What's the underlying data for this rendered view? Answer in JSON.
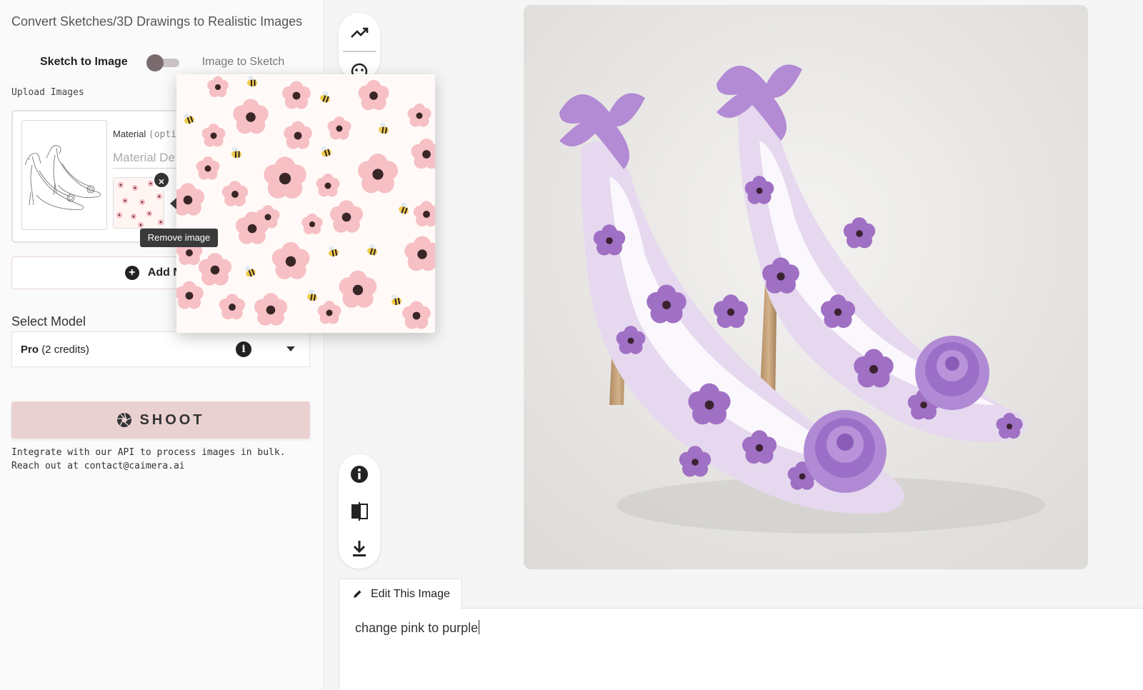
{
  "app_title": "Convert Sketches/3D Drawings to Realistic Images",
  "mode_toggle": {
    "left_label": "Sketch to Image",
    "right_label": "Image to Sketch",
    "selected": "Sketch to Image"
  },
  "upload": {
    "label": "Upload Images",
    "material_label": "Material",
    "material_optional": "(opti",
    "material_placeholder": "Material De",
    "remove_tooltip": "Remove image"
  },
  "add_new_label": "Add New",
  "model": {
    "label": "Select Model",
    "name": "Pro",
    "credits": "(2 credits)"
  },
  "shoot_label": "SHOOT",
  "api_note": {
    "line1": "Integrate with our API to process images in bulk.",
    "line2": "Reach out at contact@caimera.ai"
  },
  "toolbar_top": [
    "trend-icon",
    "face-icon"
  ],
  "toolbar_bottom": [
    "info-icon",
    "compare-icon",
    "download-icon"
  ],
  "edit": {
    "tab_label": "Edit This Image",
    "prompt_value": "change pink to purple"
  },
  "colors": {
    "accent": "#ead1d1",
    "knob": "#7a6c6e",
    "petal": "#f4b6bd",
    "purple": "#a070c4"
  }
}
